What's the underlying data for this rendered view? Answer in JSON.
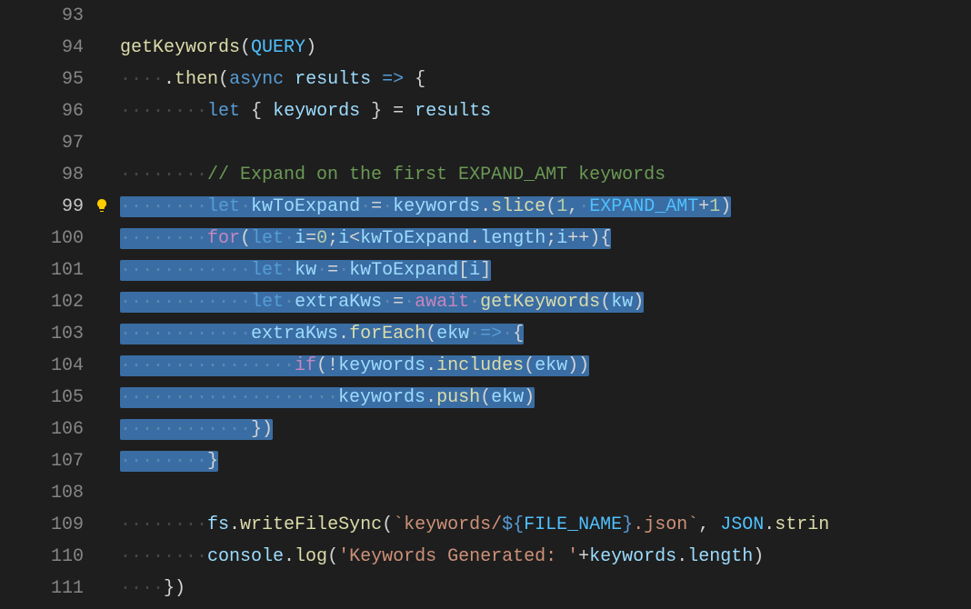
{
  "line_numbers": [
    "93",
    "94",
    "95",
    "96",
    "97",
    "98",
    "99",
    "100",
    "101",
    "102",
    "103",
    "104",
    "105",
    "106",
    "107",
    "108",
    "109",
    "110",
    "111"
  ],
  "bulb_line": "99",
  "strings": {
    "template_start": "keywords/",
    "template_end": ".json",
    "log_prefix": "Keywords Generated: "
  },
  "identifiers": {
    "getKeywords": "getKeywords",
    "QUERY": "QUERY",
    "then": "then",
    "async": "async",
    "results": "results",
    "let": "let",
    "keywords": "keywords",
    "comment": "// Expand on the first EXPAND_AMT keywords",
    "kwToExpand": "kwToExpand",
    "slice": "slice",
    "one": "1",
    "EXPAND_AMT": "EXPAND_AMT",
    "for": "for",
    "i": "i",
    "zero": "0",
    "length": "length",
    "kw": "kw",
    "extraKws": "extraKws",
    "await": "await",
    "forEach": "forEach",
    "ekw": "ekw",
    "if": "if",
    "includes": "includes",
    "push": "push",
    "fs": "fs",
    "writeFileSync": "writeFileSync",
    "FILE_NAME": "FILE_NAME",
    "JSON": "JSON",
    "strin": "strin",
    "console": "console",
    "log": "log"
  }
}
